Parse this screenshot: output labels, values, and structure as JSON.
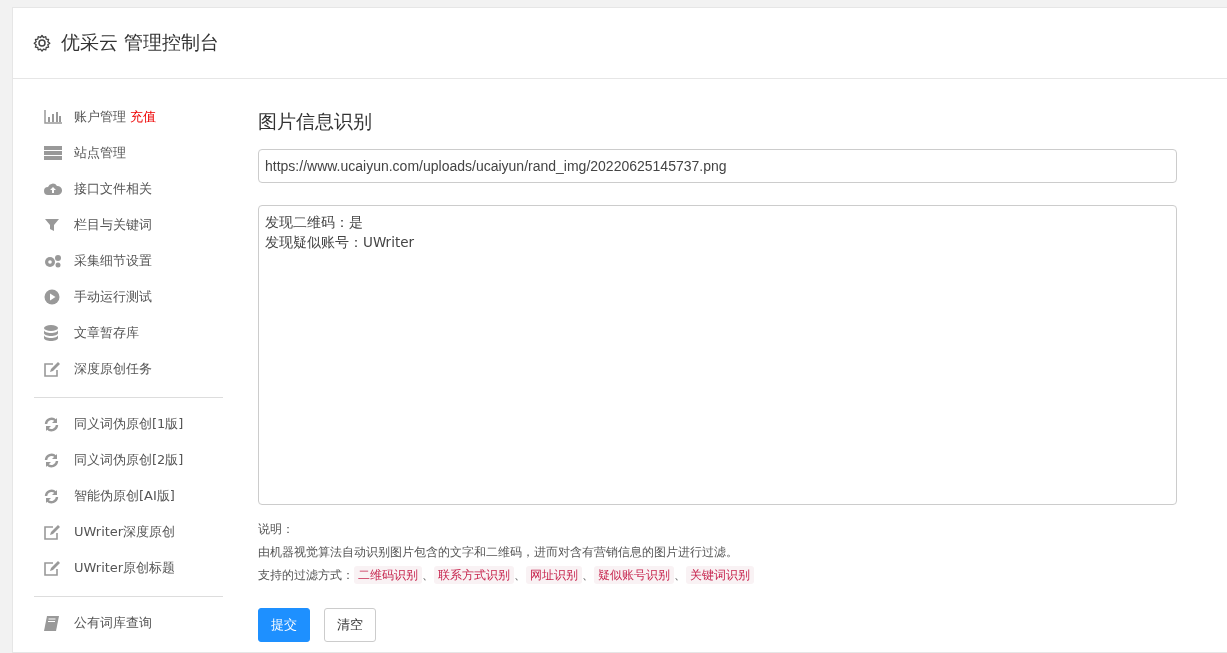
{
  "header": {
    "title": "优采云 管理控制台"
  },
  "sidebar": {
    "groups": [
      {
        "items": [
          {
            "label": "账户管理",
            "badge": "充值"
          },
          {
            "label": "站点管理"
          },
          {
            "label": "接口文件相关"
          },
          {
            "label": "栏目与关键词"
          },
          {
            "label": "采集细节设置"
          },
          {
            "label": "手动运行测试"
          },
          {
            "label": "文章暂存库"
          },
          {
            "label": "深度原创任务"
          }
        ]
      },
      {
        "items": [
          {
            "label": "同义词伪原创[1版]"
          },
          {
            "label": "同义词伪原创[2版]"
          },
          {
            "label": "智能伪原创[AI版]"
          },
          {
            "label": "UWriter深度原创"
          },
          {
            "label": "UWriter原创标题"
          }
        ]
      },
      {
        "items": [
          {
            "label": "公有词库查询"
          }
        ]
      }
    ]
  },
  "main": {
    "title": "图片信息识别",
    "url_field": {
      "value": "https://www.ucaiyun.com/uploads/ucaiyun/rand_img/20220625145737.png"
    },
    "result_box": {
      "lines": [
        "发现二维码：是",
        "发现疑似账号：UWriter"
      ]
    },
    "notes": {
      "heading": "说明：",
      "description": "由机器视觉算法自动识别图片包含的文字和二维码，进而对含有营销信息的图片进行过滤。",
      "methods_label": "支持的过滤方式：",
      "separator": "、",
      "methods": [
        "二维码识别",
        "联系方式识别",
        "网址识别",
        "疑似账号识别",
        "关键词识别"
      ]
    },
    "buttons": [
      {
        "label": "提交",
        "kind": "primary"
      },
      {
        "label": "清空",
        "kind": "default"
      }
    ]
  }
}
